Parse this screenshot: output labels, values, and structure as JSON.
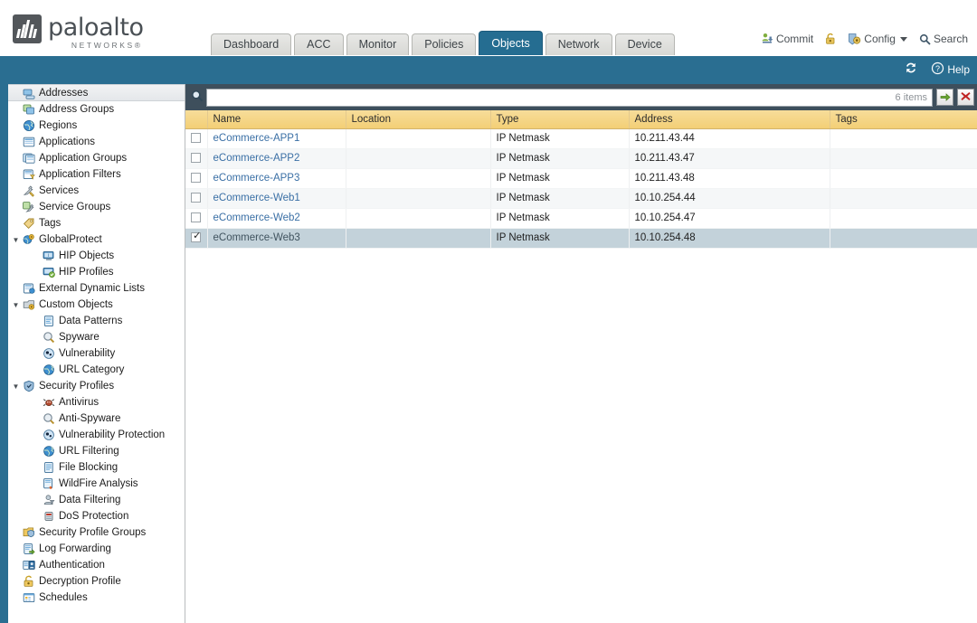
{
  "brand": {
    "name": "paloalto",
    "tagline": "NETWORKS®"
  },
  "nav_tabs": [
    {
      "label": "Dashboard",
      "active": false
    },
    {
      "label": "ACC",
      "active": false
    },
    {
      "label": "Monitor",
      "active": false
    },
    {
      "label": "Policies",
      "active": false
    },
    {
      "label": "Objects",
      "active": true
    },
    {
      "label": "Network",
      "active": false
    },
    {
      "label": "Device",
      "active": false
    }
  ],
  "top_actions": {
    "commit": "Commit",
    "config": "Config",
    "search": "Search"
  },
  "blue_bar": {
    "help": "Help"
  },
  "sidebar": {
    "items": [
      {
        "label": "Addresses",
        "icon": "addresses-icon",
        "level": 1,
        "arrow": "",
        "selected": true
      },
      {
        "label": "Address Groups",
        "icon": "address-groups-icon",
        "level": 1,
        "arrow": "",
        "selected": false
      },
      {
        "label": "Regions",
        "icon": "regions-icon",
        "level": 1,
        "arrow": "",
        "selected": false
      },
      {
        "label": "Applications",
        "icon": "applications-icon",
        "level": 1,
        "arrow": "",
        "selected": false
      },
      {
        "label": "Application Groups",
        "icon": "application-groups-icon",
        "level": 1,
        "arrow": "",
        "selected": false
      },
      {
        "label": "Application Filters",
        "icon": "application-filters-icon",
        "level": 1,
        "arrow": "",
        "selected": false
      },
      {
        "label": "Services",
        "icon": "services-icon",
        "level": 1,
        "arrow": "",
        "selected": false
      },
      {
        "label": "Service Groups",
        "icon": "service-groups-icon",
        "level": 1,
        "arrow": "",
        "selected": false
      },
      {
        "label": "Tags",
        "icon": "tags-icon",
        "level": 1,
        "arrow": "",
        "selected": false
      },
      {
        "label": "GlobalProtect",
        "icon": "globalprotect-icon",
        "level": 1,
        "arrow": "▼",
        "selected": false
      },
      {
        "label": "HIP Objects",
        "icon": "hip-objects-icon",
        "level": 2,
        "arrow": "",
        "selected": false
      },
      {
        "label": "HIP Profiles",
        "icon": "hip-profiles-icon",
        "level": 2,
        "arrow": "",
        "selected": false
      },
      {
        "label": "External Dynamic Lists",
        "icon": "external-dynamic-lists-icon",
        "level": 1,
        "arrow": "",
        "selected": false
      },
      {
        "label": "Custom Objects",
        "icon": "custom-objects-icon",
        "level": 1,
        "arrow": "▼",
        "selected": false
      },
      {
        "label": "Data Patterns",
        "icon": "data-patterns-icon",
        "level": 2,
        "arrow": "",
        "selected": false
      },
      {
        "label": "Spyware",
        "icon": "spyware-icon",
        "level": 2,
        "arrow": "",
        "selected": false
      },
      {
        "label": "Vulnerability",
        "icon": "vulnerability-icon",
        "level": 2,
        "arrow": "",
        "selected": false
      },
      {
        "label": "URL Category",
        "icon": "url-category-icon",
        "level": 2,
        "arrow": "",
        "selected": false
      },
      {
        "label": "Security Profiles",
        "icon": "security-profiles-icon",
        "level": 1,
        "arrow": "▼",
        "selected": false
      },
      {
        "label": "Antivirus",
        "icon": "antivirus-icon",
        "level": 2,
        "arrow": "",
        "selected": false
      },
      {
        "label": "Anti-Spyware",
        "icon": "anti-spyware-icon",
        "level": 2,
        "arrow": "",
        "selected": false
      },
      {
        "label": "Vulnerability Protection",
        "icon": "vulnerability-protection-icon",
        "level": 2,
        "arrow": "",
        "selected": false
      },
      {
        "label": "URL Filtering",
        "icon": "url-filtering-icon",
        "level": 2,
        "arrow": "",
        "selected": false
      },
      {
        "label": "File Blocking",
        "icon": "file-blocking-icon",
        "level": 2,
        "arrow": "",
        "selected": false
      },
      {
        "label": "WildFire Analysis",
        "icon": "wildfire-analysis-icon",
        "level": 2,
        "arrow": "",
        "selected": false
      },
      {
        "label": "Data Filtering",
        "icon": "data-filtering-icon",
        "level": 2,
        "arrow": "",
        "selected": false
      },
      {
        "label": "DoS Protection",
        "icon": "dos-protection-icon",
        "level": 2,
        "arrow": "",
        "selected": false
      },
      {
        "label": "Security Profile Groups",
        "icon": "security-profile-groups-icon",
        "level": 1,
        "arrow": "",
        "selected": false
      },
      {
        "label": "Log Forwarding",
        "icon": "log-forwarding-icon",
        "level": 1,
        "arrow": "",
        "selected": false
      },
      {
        "label": "Authentication",
        "icon": "authentication-icon",
        "level": 1,
        "arrow": "",
        "selected": false
      },
      {
        "label": "Decryption Profile",
        "icon": "decryption-profile-icon",
        "level": 1,
        "arrow": "",
        "selected": false
      },
      {
        "label": "Schedules",
        "icon": "schedules-icon",
        "level": 1,
        "arrow": "",
        "selected": false
      }
    ]
  },
  "search": {
    "value": "",
    "placeholder": "",
    "items_count": "6 items"
  },
  "table": {
    "columns": [
      "Name",
      "Location",
      "Type",
      "Address",
      "Tags"
    ],
    "rows": [
      {
        "checked": false,
        "name": "eCommerce-APP1",
        "location": "",
        "type": "IP Netmask",
        "address": "10.211.43.44",
        "tags": ""
      },
      {
        "checked": false,
        "name": "eCommerce-APP2",
        "location": "",
        "type": "IP Netmask",
        "address": "10.211.43.47",
        "tags": ""
      },
      {
        "checked": false,
        "name": "eCommerce-APP3",
        "location": "",
        "type": "IP Netmask",
        "address": "10.211.43.48",
        "tags": ""
      },
      {
        "checked": false,
        "name": "eCommerce-Web1",
        "location": "",
        "type": "IP Netmask",
        "address": "10.10.254.44",
        "tags": ""
      },
      {
        "checked": false,
        "name": "eCommerce-Web2",
        "location": "",
        "type": "IP Netmask",
        "address": "10.10.254.47",
        "tags": ""
      },
      {
        "checked": true,
        "name": "eCommerce-Web3",
        "location": "",
        "type": "IP Netmask",
        "address": "10.10.254.48",
        "tags": ""
      }
    ]
  },
  "colors": {
    "accent_blue": "#2a6e91",
    "tab_active": "#256d91",
    "header_gold": "#f3cf76",
    "search_band": "#3e4f5c",
    "row_selected": "#c3d2da",
    "link": "#3a6fa5"
  }
}
